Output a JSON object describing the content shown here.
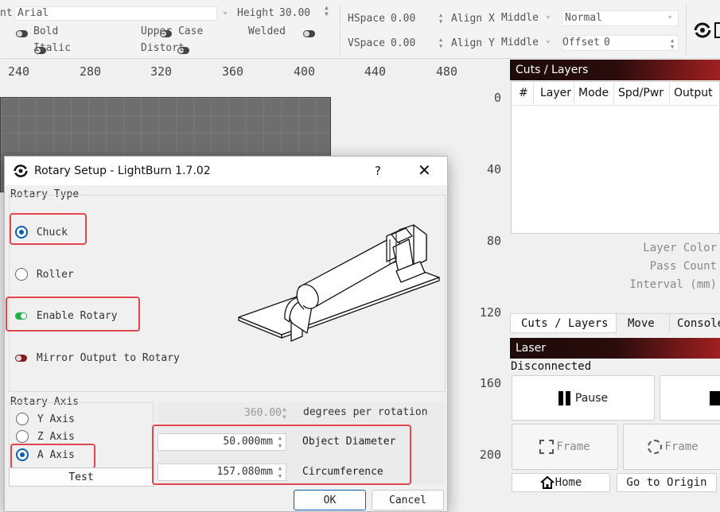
{
  "toolbar": {
    "font_label": "nt",
    "font_value": "Arial",
    "height_label": "Height",
    "height_value": "30.00",
    "bold": "Bold",
    "italic": "Italic",
    "upper_case": "Upper Case",
    "distort": "Distort",
    "welded": "Welded",
    "hspace_label": "HSpace",
    "hspace_value": "0.00",
    "vspace_label": "VSpace",
    "vspace_value": "0.00",
    "align_x_label": "Align X",
    "align_x_value": "Middle",
    "align_y_label": "Align Y",
    "align_y_value": "Middle",
    "mode_value": "Normal",
    "offset_label": "Offset",
    "offset_value": "0"
  },
  "ruler": {
    "h_ticks": [
      "240",
      "280",
      "320",
      "360",
      "400",
      "440",
      "480"
    ],
    "v_ticks": [
      "0",
      "40",
      "80",
      "120",
      "160",
      "200"
    ]
  },
  "cuts_layers": {
    "title": "Cuts / Layers",
    "columns": [
      "#",
      "Layer",
      "Mode",
      "Spd/Pwr",
      "Output"
    ],
    "layer_color": "Layer Color",
    "pass_count": "Pass Count",
    "interval": "Interval (mm)",
    "tabs": [
      "Cuts / Layers",
      "Move",
      "Console"
    ]
  },
  "laser": {
    "title": "Laser",
    "status": "Disconnected",
    "pause": "Pause",
    "frame1": "Frame",
    "frame2": "Frame",
    "home": "Home",
    "go_to_origin": "Go to Origin"
  },
  "dialog": {
    "title": "Rotary Setup - LightBurn 1.7.02",
    "help": "?",
    "rotary_type_label": "Rotary Type",
    "chuck": "Chuck",
    "roller": "Roller",
    "enable_rotary": "Enable Rotary",
    "mirror_output": "Mirror Output to Rotary",
    "rotary_axis_label": "Rotary Axis",
    "y_axis": "Y Axis",
    "z_axis": "Z Axis",
    "a_axis": "A Axis",
    "test": "Test",
    "degrees_value": "360.00",
    "degrees_label": "degrees per rotation",
    "object_diameter_value": "50.000mm",
    "object_diameter_label": "Object Diameter",
    "circumference_value": "157.080mm",
    "circumference_label": "Circumference",
    "ok": "OK",
    "cancel": "Cancel"
  },
  "colors": {
    "accent": "#0a5fb4",
    "highlight_box": "#e0474c",
    "toggle_on": "#19b34a",
    "toggle_off_red": "#8a1d1d"
  }
}
